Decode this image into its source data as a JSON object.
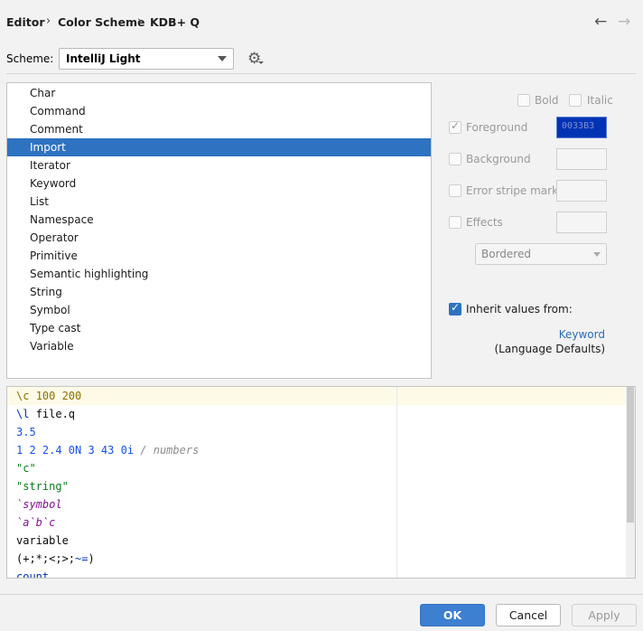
{
  "breadcrumb": {
    "item1": "Editor",
    "item2": "Color Scheme",
    "item3": "KDB+ Q",
    "sep": "›"
  },
  "nav": {
    "back": "←",
    "forward": "→"
  },
  "scheme": {
    "label": "Scheme:",
    "value": "IntelliJ Light",
    "gear": "⚙"
  },
  "attributes": [
    {
      "label": "Char"
    },
    {
      "label": "Command"
    },
    {
      "label": "Comment"
    },
    {
      "label": "Import",
      "selected": true
    },
    {
      "label": "Iterator"
    },
    {
      "label": "Keyword"
    },
    {
      "label": "List"
    },
    {
      "label": "Namespace"
    },
    {
      "label": "Operator"
    },
    {
      "label": "Primitive"
    },
    {
      "label": "Semantic highlighting"
    },
    {
      "label": "String"
    },
    {
      "label": "Symbol"
    },
    {
      "label": "Type cast"
    },
    {
      "label": "Variable"
    }
  ],
  "options": {
    "bold": {
      "label": "Bold",
      "checked": false
    },
    "italic": {
      "label": "Italic",
      "checked": false
    },
    "foreground": {
      "label": "Foreground",
      "checked": true,
      "color_text": "0033B3",
      "color": "#0033b3"
    },
    "background": {
      "label": "Background",
      "checked": false
    },
    "error_stripe": {
      "label": "Error stripe mark",
      "checked": false
    },
    "effects": {
      "label": "Effects",
      "checked": false,
      "style": "Bordered"
    },
    "inherit": {
      "label": "Inherit values from:",
      "checked": true,
      "link": "Keyword",
      "sub": "(Language Defaults)"
    }
  },
  "preview": {
    "line1": {
      "dir": "\\c",
      "nums": "100 200"
    },
    "line2": {
      "dir": "\\l",
      "rest": "file.q"
    },
    "line3": "3.5",
    "line4": {
      "nums": "1 2 2.4 0N 3 43 0i",
      "comment": "/ numbers"
    },
    "line5": "\"c\"",
    "line6": "\"string\"",
    "line7": "`symbol",
    "line8": "`a`b`c",
    "line9": "variable",
    "line10": {
      "paren_open": "(",
      "ops_a": "+;*;<;>;",
      "ops_b": "~=",
      "paren_close": ")"
    },
    "line11": "count"
  },
  "buttons": {
    "ok": "OK",
    "cancel": "Cancel",
    "apply": "Apply"
  }
}
